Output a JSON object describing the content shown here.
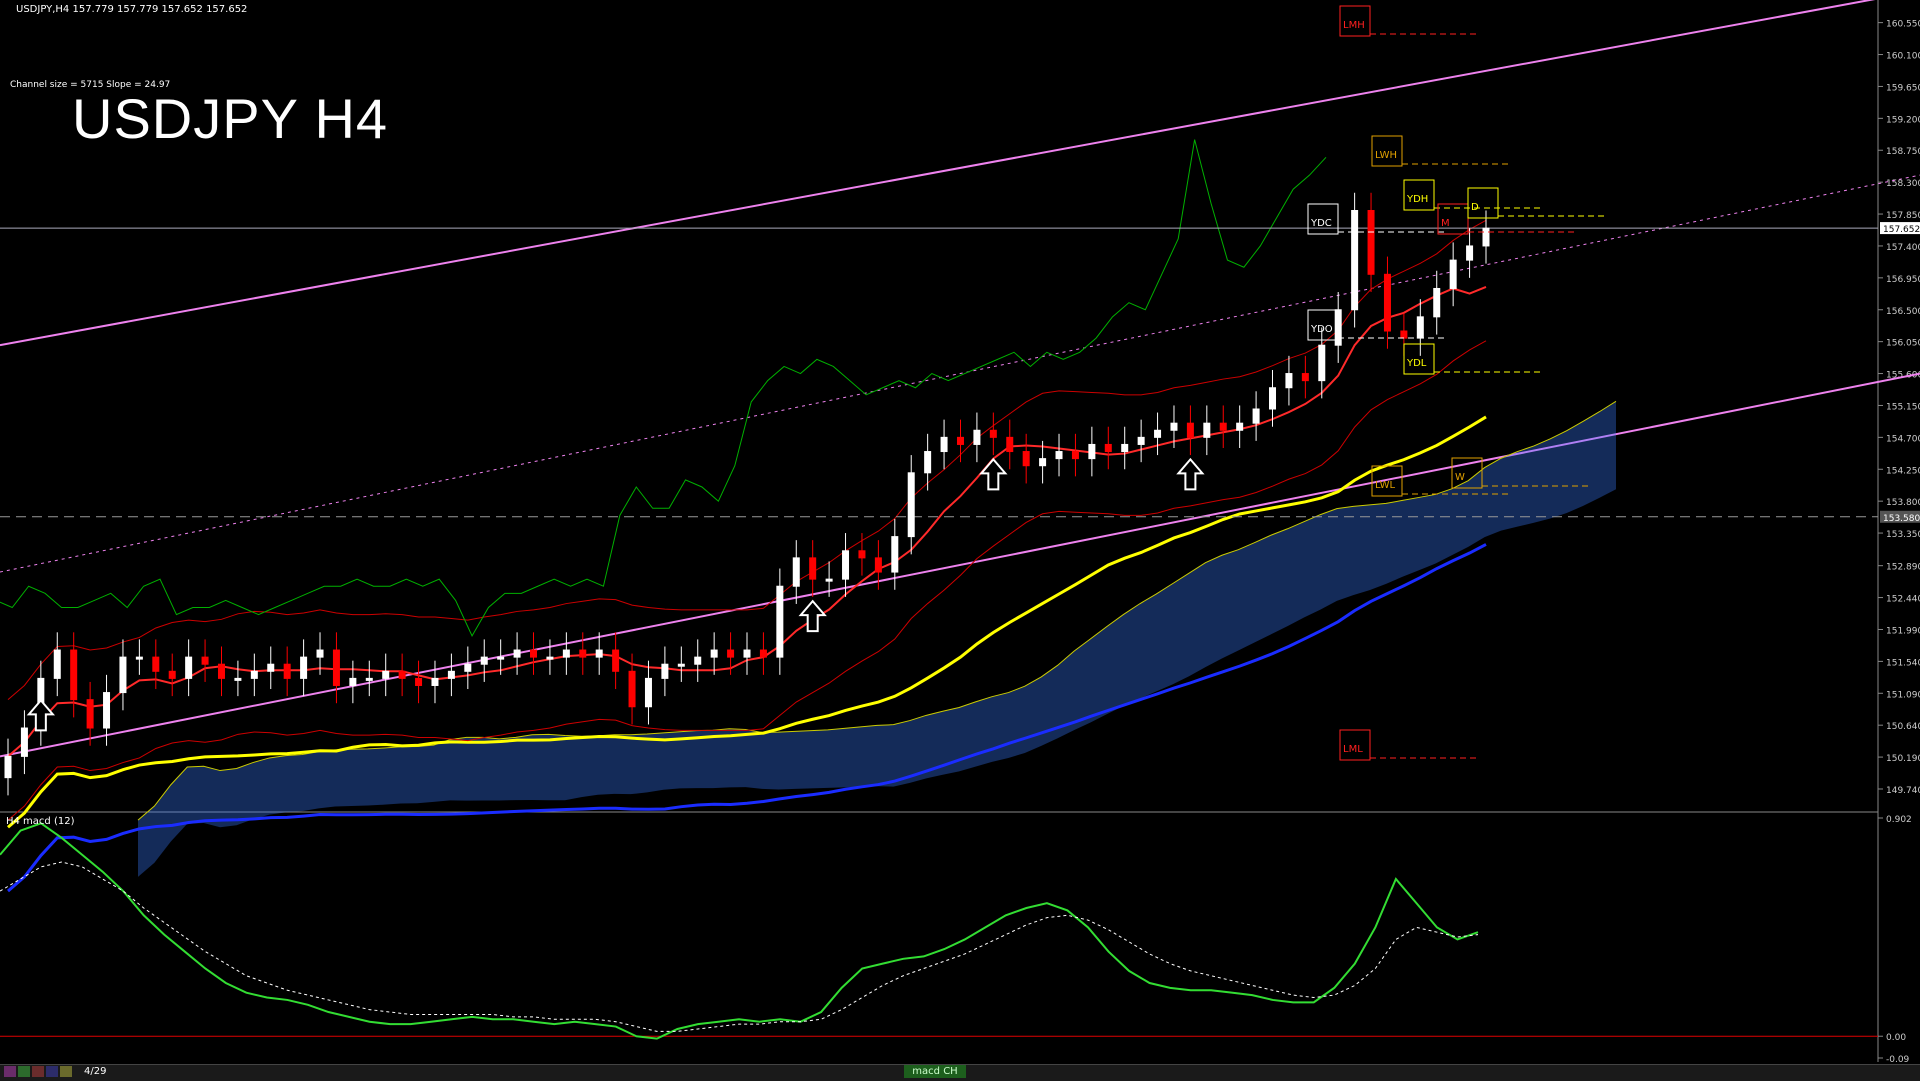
{
  "header": {
    "ticker_line": "USDJPY,H4  157.779 157.779 157.652 157.652",
    "channel_info": "Channel size = 5715 Slope = 24.97",
    "big_title": "USDJPY H4"
  },
  "subwindow": {
    "label": "H4  macd (12)"
  },
  "bottom_bar": {
    "page_label": "4/29",
    "macd_tab": "macd CH"
  },
  "colors": {
    "background": "#000000",
    "bull_candle": "#ffffff",
    "bear_candle": "#ff0000",
    "ema_yellow": "#ffff00",
    "ema_blue": "#1a2cff",
    "channel_magenta": "#ee82ee",
    "cloud": "#3a7bff",
    "chikou": "#00b000",
    "macd": "#33dd33",
    "signal": "#ffffff"
  },
  "chart_data": [
    {
      "type": "candlestick",
      "symbol": "USDJPY",
      "timeframe": "H4",
      "ylim": [
        149.5,
        160.7
      ],
      "yticks": [
        "160.550",
        "160.100",
        "159.650",
        "159.200",
        "158.750",
        "158.300",
        "157.850",
        "157.400",
        "156.950",
        "156.500",
        "156.050",
        "155.600",
        "155.150",
        "154.700",
        "154.250",
        "153.800",
        "153.350",
        "152.890",
        "152.440",
        "151.990",
        "151.540",
        "151.090",
        "150.640",
        "150.190",
        "149.740"
      ],
      "current_price": "157.652",
      "marked_level": "153.580",
      "close": [
        150.2,
        150.6,
        151.3,
        151.7,
        151.0,
        150.6,
        151.1,
        151.6,
        151.6,
        151.4,
        151.3,
        151.6,
        151.5,
        151.3,
        151.3,
        151.4,
        151.5,
        151.3,
        151.6,
        151.7,
        151.2,
        151.3,
        151.3,
        151.4,
        151.3,
        151.2,
        151.3,
        151.4,
        151.5,
        151.6,
        151.6,
        151.7,
        151.6,
        151.6,
        151.7,
        151.6,
        151.7,
        151.4,
        150.9,
        151.3,
        151.5,
        151.5,
        151.6,
        151.7,
        151.6,
        151.7,
        151.6,
        152.6,
        153.0,
        152.7,
        152.7,
        153.1,
        153.0,
        152.8,
        153.3,
        154.2,
        154.5,
        154.7,
        154.6,
        154.8,
        154.7,
        154.5,
        154.3,
        154.4,
        154.5,
        154.4,
        154.6,
        154.5,
        154.6,
        154.7,
        154.8,
        154.9,
        154.7,
        154.9,
        154.8,
        154.9,
        155.1,
        155.4,
        155.6,
        155.5,
        156.0,
        156.5,
        157.9,
        157.0,
        156.2,
        156.1,
        156.4,
        156.8,
        157.2,
        157.4,
        157.65
      ],
      "level_labels": [
        "LMH",
        "LWH",
        "YDC",
        "YDH",
        "M",
        "D",
        "YDO",
        "YDL",
        "LWL",
        "W",
        "LML"
      ],
      "arrows": [
        {
          "i": 2,
          "dir": "up"
        },
        {
          "i": 49,
          "dir": "up"
        },
        {
          "i": 60,
          "dir": "up"
        },
        {
          "i": 72,
          "dir": "up"
        }
      ]
    },
    {
      "type": "line",
      "name": "macd (12)",
      "ylim": [
        -0.09,
        0.902
      ],
      "yticks": [
        "0.902",
        "0.00",
        "-0.09"
      ],
      "macd": [
        0.75,
        0.85,
        0.88,
        0.82,
        0.75,
        0.68,
        0.6,
        0.5,
        0.42,
        0.35,
        0.28,
        0.22,
        0.18,
        0.16,
        0.15,
        0.13,
        0.1,
        0.08,
        0.06,
        0.05,
        0.05,
        0.06,
        0.07,
        0.08,
        0.07,
        0.07,
        0.06,
        0.05,
        0.06,
        0.05,
        0.04,
        0.0,
        -0.01,
        0.03,
        0.05,
        0.06,
        0.07,
        0.06,
        0.07,
        0.06,
        0.1,
        0.2,
        0.28,
        0.3,
        0.32,
        0.33,
        0.36,
        0.4,
        0.45,
        0.5,
        0.53,
        0.55,
        0.52,
        0.45,
        0.35,
        0.27,
        0.22,
        0.2,
        0.19,
        0.19,
        0.18,
        0.17,
        0.15,
        0.14,
        0.14,
        0.2,
        0.3,
        0.45,
        0.65,
        0.55,
        0.45,
        0.4,
        0.43
      ],
      "signal": [
        0.6,
        0.65,
        0.7,
        0.72,
        0.7,
        0.65,
        0.6,
        0.53,
        0.47,
        0.41,
        0.35,
        0.3,
        0.25,
        0.22,
        0.19,
        0.17,
        0.15,
        0.13,
        0.11,
        0.1,
        0.09,
        0.09,
        0.09,
        0.09,
        0.09,
        0.08,
        0.08,
        0.07,
        0.07,
        0.07,
        0.06,
        0.04,
        0.02,
        0.02,
        0.03,
        0.04,
        0.05,
        0.05,
        0.06,
        0.06,
        0.07,
        0.11,
        0.16,
        0.21,
        0.25,
        0.28,
        0.31,
        0.34,
        0.38,
        0.42,
        0.46,
        0.49,
        0.5,
        0.48,
        0.44,
        0.39,
        0.34,
        0.3,
        0.27,
        0.25,
        0.23,
        0.21,
        0.19,
        0.17,
        0.16,
        0.17,
        0.21,
        0.28,
        0.4,
        0.45,
        0.43,
        0.41,
        0.42
      ]
    }
  ]
}
